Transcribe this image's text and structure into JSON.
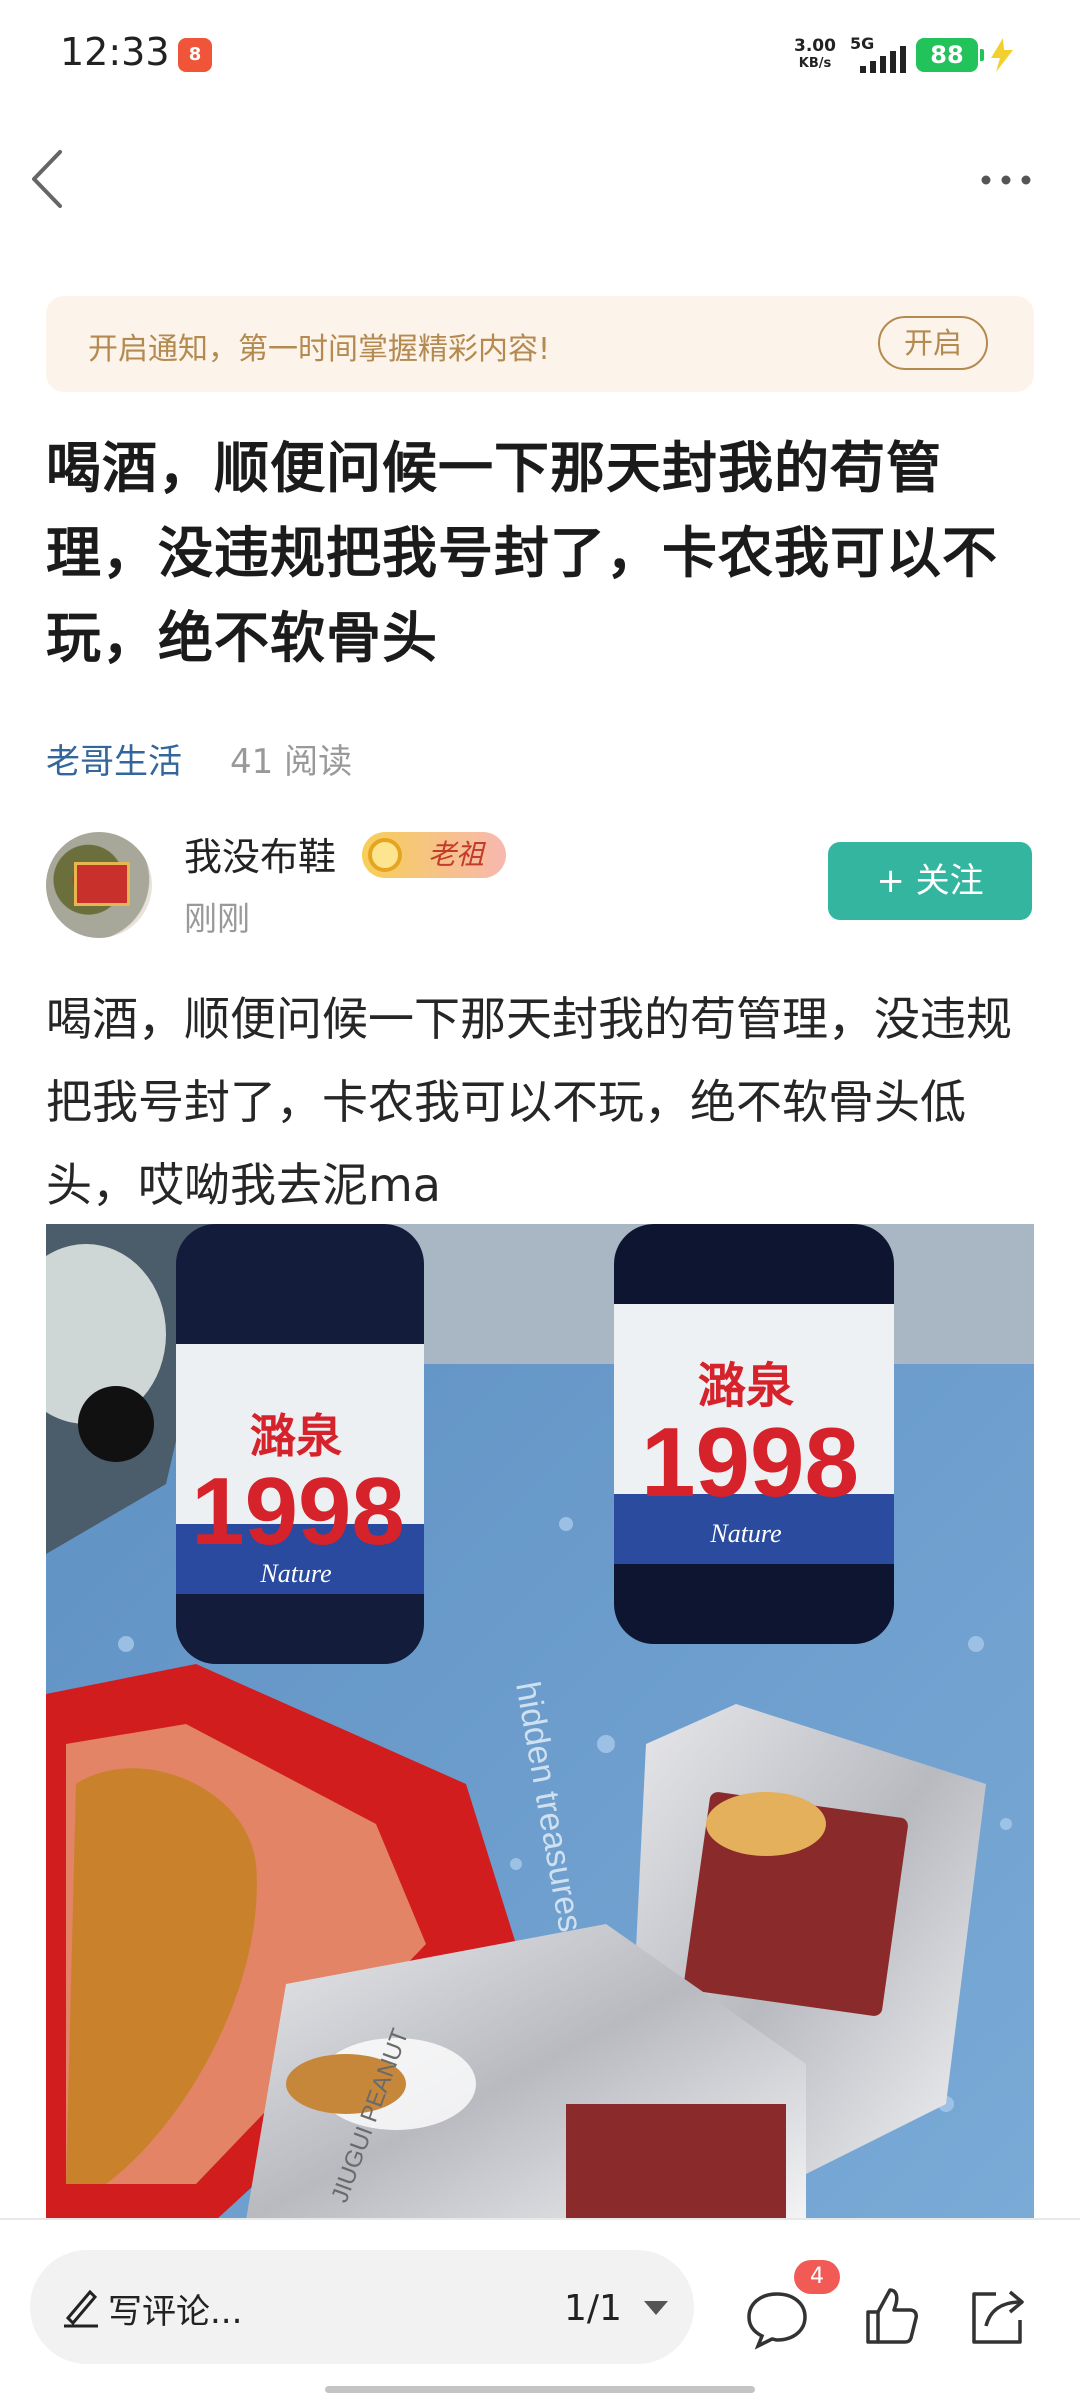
{
  "status_bar": {
    "time": "12:33",
    "app_icon_text": "8",
    "net_speed_value": "3.00",
    "net_speed_unit": "KB/s",
    "network_type": "5G",
    "battery": "88"
  },
  "notify": {
    "text": "开启通知，第一时间掌握精彩内容!",
    "button": "开启"
  },
  "post": {
    "title": "喝酒，顺便问候一下那天封我的苟管理，没违规把我号封了，卡农我可以不玩，绝不软骨头",
    "channel": "老哥生活",
    "read_count": "41 阅读",
    "author": {
      "name": "我没布鞋",
      "badge": "老祖",
      "time": "刚刚"
    },
    "follow_label": "+ 关注",
    "body": "喝酒，顺便问候一下那天封我的苟管理，没违规把我号封了，卡农我可以不玩，绝不软骨头低头，哎呦我去泥ma",
    "image": {
      "bottle_brand": "潞泉",
      "bottle_number": "1998",
      "bottle_sub": "Nature",
      "mat_text": "hidden treasures. dream.",
      "snack_text": "JIUGUI PEANUT"
    }
  },
  "bottom_bar": {
    "comment_placeholder": "写评论...",
    "page_indicator": "1/1",
    "comment_count": "4"
  },
  "icons": {
    "back": "back-icon",
    "more": "more-icon",
    "pen": "pen-icon",
    "comment": "comment-icon",
    "like": "like-icon",
    "share": "share-icon"
  },
  "colors": {
    "follow_button": "#33b5a0",
    "notify_bg": "#fcf4ea",
    "notify_accent": "#b48a50",
    "channel_link": "#33669a",
    "battery": "#22c35b",
    "badge_red": "#f25b55"
  }
}
